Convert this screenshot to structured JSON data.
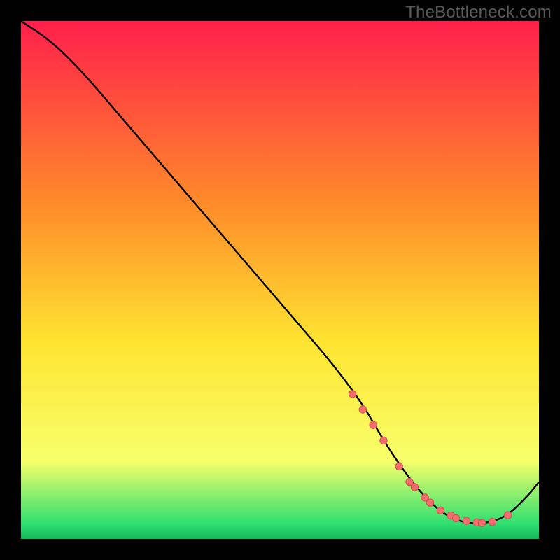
{
  "watermark": "TheBottleneck.com",
  "colors": {
    "gradient_top": "#ff1f4b",
    "gradient_mid1": "#ff8a2a",
    "gradient_mid2": "#ffe431",
    "gradient_low": "#f7ff6b",
    "gradient_green": "#2fe070",
    "curve": "#000000",
    "marker_fill": "#f26d6d",
    "marker_stroke": "#d94d4d"
  },
  "chart_data": {
    "type": "line",
    "title": "",
    "xlabel": "",
    "ylabel": "",
    "xlim": [
      0,
      100
    ],
    "ylim": [
      0,
      100
    ],
    "curve": {
      "x": [
        0,
        6,
        12,
        18,
        24,
        30,
        36,
        42,
        48,
        54,
        60,
        66,
        70,
        74,
        78,
        82,
        86,
        90,
        94,
        98,
        100
      ],
      "y": [
        100,
        96,
        90,
        83,
        76,
        69,
        62,
        55,
        48,
        41,
        34,
        26,
        19,
        13,
        8,
        4.5,
        3,
        3,
        4.5,
        8.5,
        11
      ]
    },
    "markers": {
      "x": [
        64,
        66,
        68,
        70,
        73,
        75,
        76,
        78,
        79,
        81,
        83,
        84,
        86,
        88,
        89,
        91,
        94
      ],
      "y": [
        28,
        25,
        22,
        19,
        14,
        11,
        10,
        8,
        7,
        5.5,
        4.5,
        4,
        3.5,
        3.2,
        3.1,
        3.3,
        4.6
      ]
    }
  }
}
